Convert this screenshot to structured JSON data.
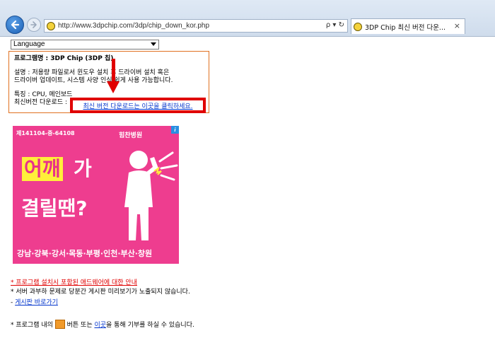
{
  "browser": {
    "url": "http://www.3dpchip.com/3dp/chip_down_kor.php",
    "url_tools": "ρ ▾ ↻",
    "tab_title": "3DP Chip 최신 버전 다운...",
    "tab_close": "×"
  },
  "language_select": {
    "selected": "Language"
  },
  "info": {
    "program_name": "프로그램명 : 3DP Chip (3DP 칩)",
    "description_line1": "설명 : 저용량 파일로서 윈도우 설치 후 드라이버 설치 혹은",
    "description_line2": "드라이버 업데이트, 시스템 사양 인식 쉽게 사용 가능합니다.",
    "features_line1": "특징 : CPU, 메인보드",
    "latest_label": "최신버전 다운로드 :"
  },
  "download_link": "최신 버전 다운로드는 이곳을 클릭하세요.",
  "ad": {
    "id_text": "제141104-중-64108",
    "brand": "힘찬병원",
    "info_badge": "i",
    "headline_highlight": "어깨",
    "headline_suffix": "가",
    "headline_line2": "결릴땐?",
    "regions": "강남·강북·강서·목동·부평·인천·부산·창원"
  },
  "notes": {
    "adware_notice": "* 프로그램 설치시 포함된 애드웨어에 대한 안내",
    "server_notice": "* 서버 과부하 문제로 당분간 게시판 미리보기가 노출되지 않습니다.",
    "board_prefix": "- ",
    "board_link": "게시판 바로가기",
    "donate_prefix": "* 프로그램 내의 ",
    "donate_middle": " 버튼 또는 ",
    "donate_link": "이곳",
    "donate_suffix": "을 통해 기부를 하실 수 있습니다."
  },
  "colors": {
    "highlight_red": "#e00000",
    "ad_pink": "#ee3d8f",
    "link_blue": "#0033cc"
  }
}
